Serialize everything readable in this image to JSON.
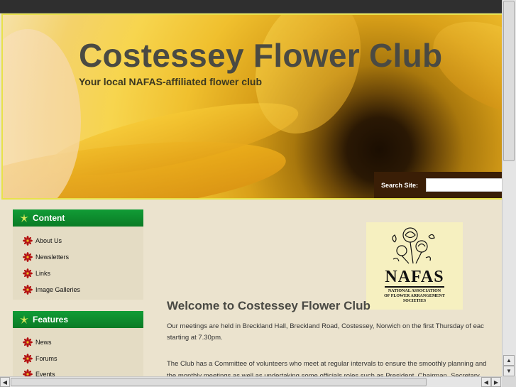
{
  "header": {
    "title": "Costessey Flower Club",
    "tagline": "Your local NAFAS-affiliated flower club",
    "search": {
      "label": "Search Site:",
      "value": ""
    }
  },
  "sidebar": {
    "blocks": [
      {
        "title": "Content",
        "items": [
          {
            "label": "About Us"
          },
          {
            "label": "Newsletters"
          },
          {
            "label": "Links"
          },
          {
            "label": "Image Galleries"
          }
        ]
      },
      {
        "title": "Features",
        "items": [
          {
            "label": "News"
          },
          {
            "label": "Forums"
          },
          {
            "label": "Events"
          }
        ]
      }
    ]
  },
  "logo": {
    "name": "NAFAS",
    "lines": [
      "NATIONAL ASSOCIATION",
      "OF FLOWER ARRANGEMENT",
      "SOCIETIES"
    ]
  },
  "main": {
    "heading": "Welcome to Costessey Flower Club",
    "paragraphs": [
      "Our meetings are held in Breckland Hall, Breckland Road, Costessey, Norwich on the first Thursday of eac",
      "starting at 7.30pm.",
      "The Club has a Committee of volunteers who meet at regular intervals to ensure the smoothly planning and",
      "the monthly meetings as well as undertaking some officials roles such as President, Chairman, Secretary"
    ]
  },
  "colors": {
    "accent_green": "#0a8a2c",
    "search_bg": "#3a1e06",
    "page_bg": "#ebe3ce"
  },
  "icons": {
    "block_icon": "leaf-icon",
    "menu_icon": "red-flower-icon"
  }
}
